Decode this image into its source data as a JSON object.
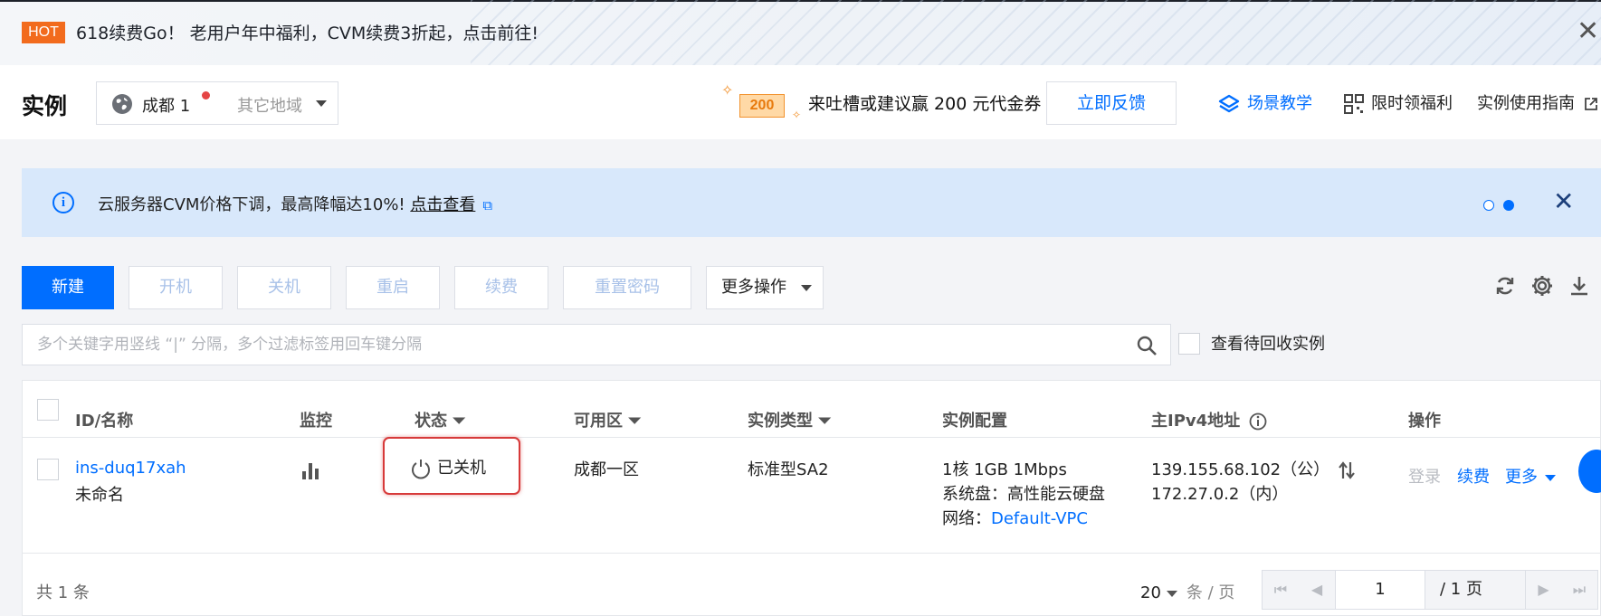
{
  "promo": {
    "hot_label": "HOT",
    "text": "618续费Go！ 老用户年中福利，CVM续费3折起，点击前往!"
  },
  "header": {
    "title": "实例",
    "region_current": "成都 1",
    "region_other": "其它地域",
    "coupon_amount": "200",
    "feedback_text": "来吐槽或建议赢 200 元代金券",
    "feedback_button": "立即反馈",
    "links": {
      "scene": "场景教学",
      "welfare": "限时领福利",
      "guide": "实例使用指南"
    }
  },
  "notice": {
    "message": "云服务器CVM价格下调，最高降幅达10%! ",
    "link_text": "点击查看"
  },
  "toolbar": {
    "create": "新建",
    "start": "开机",
    "stop": "关机",
    "restart": "重启",
    "renew": "续费",
    "reset_password": "重置密码",
    "more_actions": "更多操作"
  },
  "search": {
    "placeholder": "多个关键字用竖线 “|” 分隔，多个过滤标签用回车键分隔",
    "recycle_label": "查看待回收实例"
  },
  "table": {
    "columns": {
      "id_name": "ID/名称",
      "monitor": "监控",
      "status": "状态",
      "zone": "可用区",
      "instance_type": "实例类型",
      "config": "实例配置",
      "ipv4": "主IPv4地址",
      "actions": "操作"
    },
    "rows": [
      {
        "id": "ins-duq17xah",
        "name": "未命名",
        "status": "已关机",
        "zone": "成都一区",
        "type": "标准型SA2",
        "config_line1": "1核 1GB 1Mbps",
        "config_line2": "系统盘：高性能云硬盘",
        "network_label": "网络：",
        "network_value": "Default-VPC",
        "ip_public": "139.155.68.102（公）",
        "ip_private": "172.27.0.2（内）",
        "action_login": "登录",
        "action_renew": "续费",
        "action_more": "更多"
      }
    ]
  },
  "footer": {
    "total": "共 1 条",
    "page_size": "20",
    "page_size_unit": "条 / 页",
    "current_page": "1",
    "total_pages": "/ 1 页"
  },
  "colors": {
    "primary": "#006eff",
    "hot": "#f26b1d",
    "notice_bg": "#d8e8fb",
    "highlight_border": "#d73a3a"
  }
}
